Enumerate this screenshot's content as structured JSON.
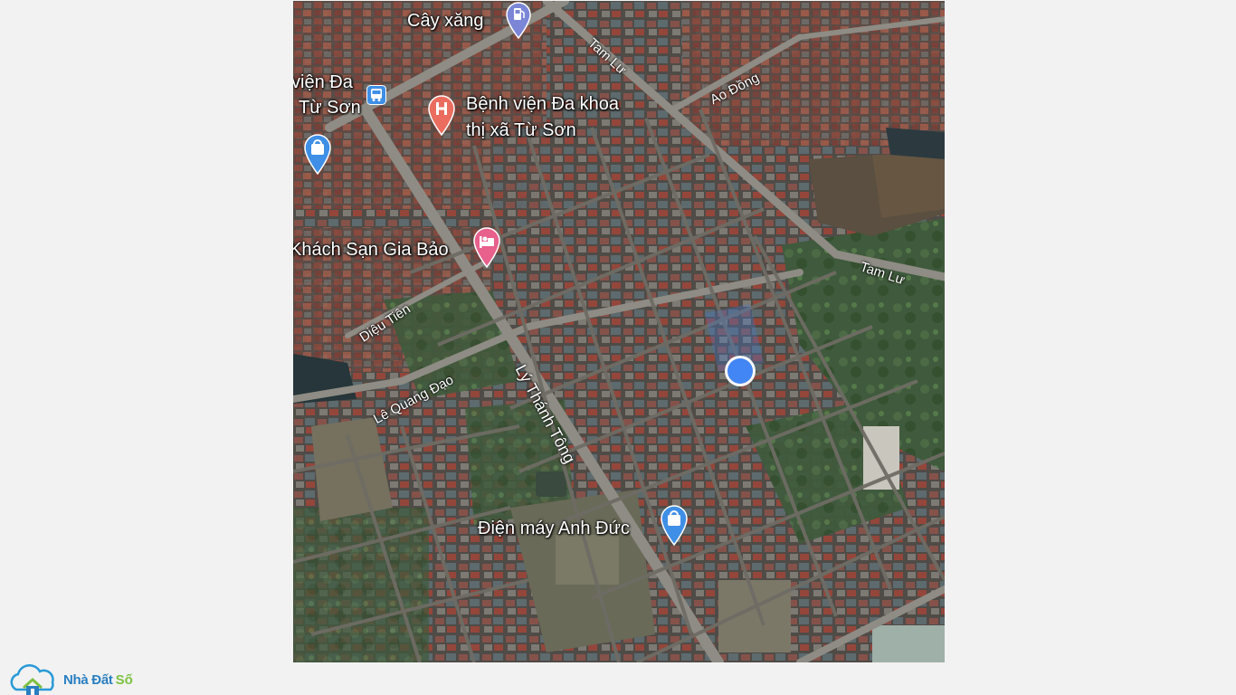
{
  "map": {
    "pois": {
      "gas_station": "Cây xăng",
      "hospital_line1": "Bệnh viện Đa khoa",
      "hospital_line2": "thị xã Từ Sơn",
      "hospital_left_line1": "viện Đa",
      "hospital_left_line2": "Từ Sơn",
      "hotel": "Khách Sạn Gia Bảo",
      "electronics_store": "Điện máy Anh Đức"
    },
    "roads": {
      "tam_lu_top": "Tam Lư",
      "ao_dong": "Ao Đồng",
      "tam_lu_right": "Tam Lư",
      "dieu_tien": "Diệu Tiên",
      "le_quang_dao": "Lê Quang Đạo",
      "ly_thanh_tong": "Lý Thánh Tông"
    },
    "colors": {
      "location_dot": "#4285f4",
      "gas_pin": "#7b86d6",
      "hospital_pin": "#ea6d5f",
      "hotel_pin": "#e8608c",
      "shop_pin": "#3f8fe6",
      "bus_icon": "#3f8fe6"
    }
  },
  "logo": {
    "brand_part1": "Nhà Đất",
    "brand_part2": "Số"
  }
}
